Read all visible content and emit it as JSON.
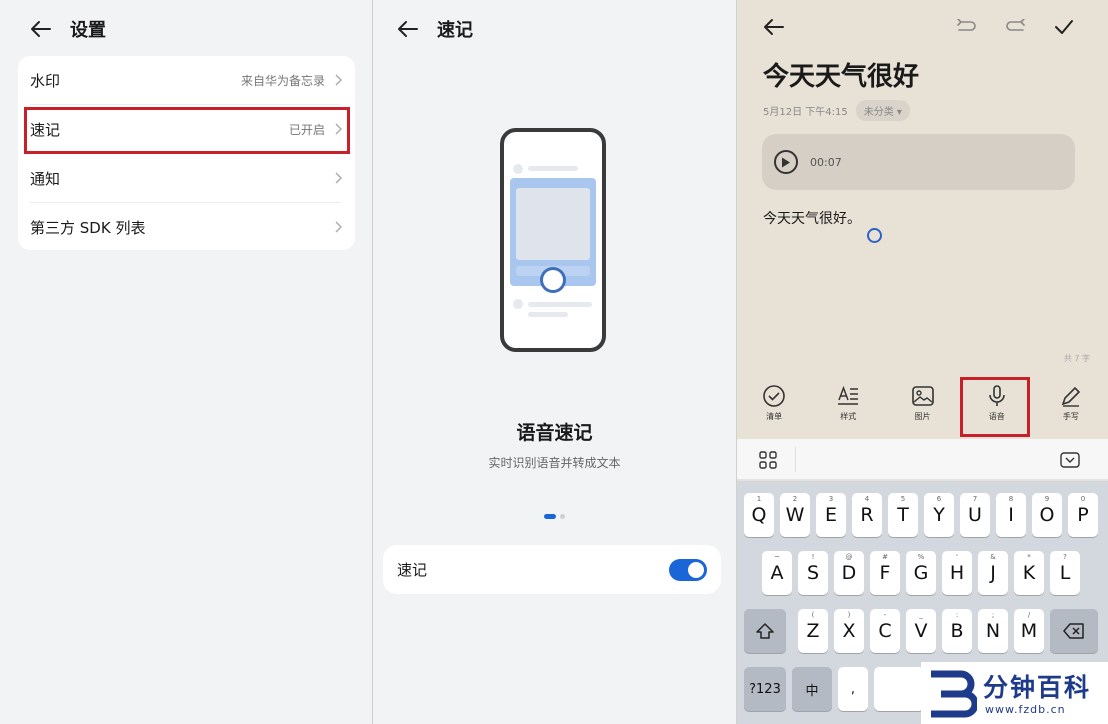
{
  "panel1": {
    "title": "设置",
    "rows": [
      {
        "label": "水印",
        "value": "来自华为备忘录"
      },
      {
        "label": "速记",
        "value": "已开启"
      },
      {
        "label": "通知",
        "value": ""
      },
      {
        "label": "第三方 SDK 列表",
        "value": ""
      }
    ],
    "highlight_color": "#c8202a"
  },
  "panel2": {
    "title": "速记",
    "feature_title": "语音速记",
    "feature_subtitle": "实时识别语音并转成文本",
    "toggle_label": "速记",
    "toggle_on": true,
    "accent": "#1a66d9"
  },
  "panel3": {
    "note_title": "今天天气很好",
    "date": "5月12日 下午4:15",
    "category": "未分类",
    "audio_duration": "00:07",
    "body": "今天天气很好。",
    "word_count": "共 7 字",
    "toolbar": [
      {
        "label": "清单",
        "icon": "checklist-icon"
      },
      {
        "label": "样式",
        "icon": "text-style-icon"
      },
      {
        "label": "图片",
        "icon": "image-icon"
      },
      {
        "label": "语音",
        "icon": "microphone-icon"
      },
      {
        "label": "手写",
        "icon": "pen-icon"
      }
    ],
    "keyboard": {
      "row1": [
        "Q",
        "W",
        "E",
        "R",
        "T",
        "Y",
        "U",
        "I",
        "O",
        "P"
      ],
      "row1_sub": [
        "1",
        "2",
        "3",
        "4",
        "5",
        "6",
        "7",
        "8",
        "9",
        "0"
      ],
      "row2": [
        "A",
        "S",
        "D",
        "F",
        "G",
        "H",
        "J",
        "K",
        "L"
      ],
      "row2_sub": [
        "~",
        "!",
        "@",
        "#",
        "%",
        "'",
        "&",
        "*",
        "?"
      ],
      "row3": [
        "Z",
        "X",
        "C",
        "V",
        "B",
        "N",
        "M"
      ],
      "row3_sub": [
        "(",
        ")",
        "-",
        "_",
        ":",
        ";",
        "/"
      ],
      "num_key": "?123",
      "lang_key": "中",
      "punct_key": ","
    }
  },
  "watermark": {
    "name": "分钟百科",
    "url": "www.fzdb.cn"
  }
}
